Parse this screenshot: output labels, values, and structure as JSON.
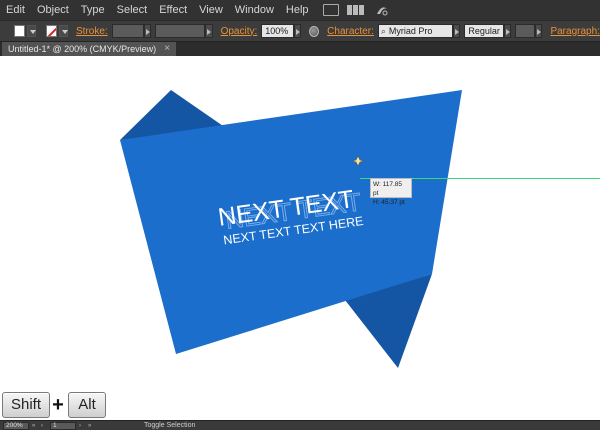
{
  "menubar": {
    "items": [
      "Edit",
      "Object",
      "Type",
      "Select",
      "Effect",
      "View",
      "Window",
      "Help"
    ],
    "icons": [
      "bridge-icon",
      "arrange-documents-icon",
      "gpu-performance-icon"
    ]
  },
  "control_bar": {
    "fill_color": "#ffffff",
    "stroke_label": "Stroke:",
    "opacity_label": "Opacity:",
    "opacity_value": "100%",
    "character_label": "Character:",
    "font_family": "Myriad Pro",
    "font_style": "Regular",
    "paragraph_label": "Paragraph:",
    "accent_color": "#e8923a"
  },
  "document_tab": {
    "title": "Untitled-1* @ 200% (CMYK/Preview)",
    "close": "×"
  },
  "artwork": {
    "line1": "NEXT TEXT",
    "line2": "NEXT TEXT TEXT  HERE",
    "main_color": "#1b6ecb",
    "fold_color": "#1456a3",
    "text_color": "#ffffff"
  },
  "size_tooltip": {
    "width": "W: 117.85 pt",
    "height": "H: 45.37 pt"
  },
  "hotkeys": {
    "key1": "Shift",
    "plus": "+",
    "key2": "Alt"
  },
  "status_bar": {
    "zoom": "200%",
    "page": "1",
    "status": "Toggle Selection"
  }
}
